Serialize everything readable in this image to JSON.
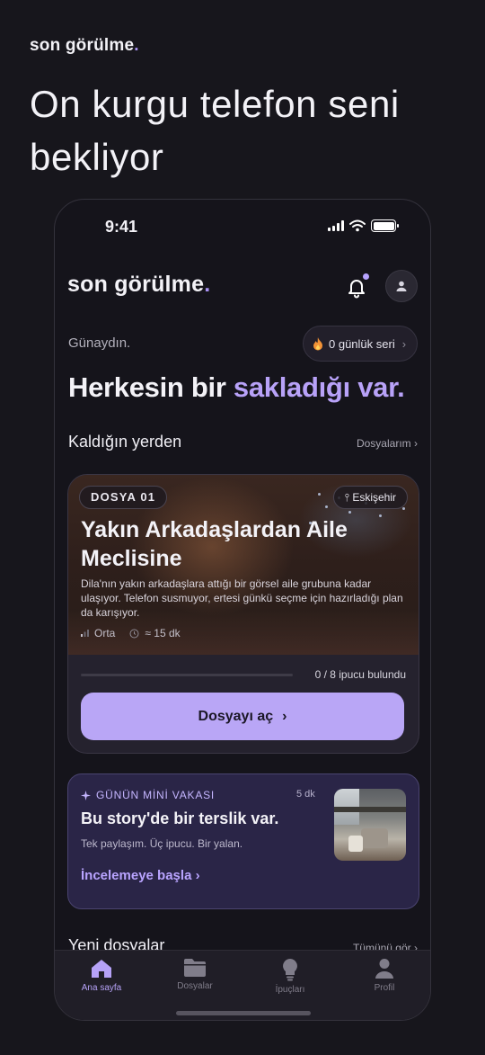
{
  "marketing": {
    "brand": "son görülme",
    "brand_dot": ".",
    "headline": "On kurgu telefon seni bekliyor"
  },
  "status_bar": {
    "time": "9:41"
  },
  "app": {
    "logo": "son görülme",
    "logo_dot": ".",
    "icons": {
      "notification": "bell-icon",
      "profile": "user-icon"
    }
  },
  "home": {
    "greeting": "Günaydın.",
    "streak_label": "0 günlük seri",
    "hero_plain": "Herkesin bir ",
    "hero_accent": "sakladığı var.",
    "continue_section": {
      "title": "Kaldığın yerden",
      "link": "Dosyalarım"
    },
    "case": {
      "badge": "DOSYA 01",
      "location": "Eskişehir",
      "title": "Yakın Arkadaşlardan Aile Meclisine",
      "description": "Dila'nın yakın arkadaşlara attığı bir görsel aile grubuna kadar ulaşıyor. Telefon susmuyor, ertesi günkü seçme için hazırladığı plan da karışıyor.",
      "difficulty": "Orta",
      "duration": "≈ 15 dk",
      "progress_label": "0 / 8 ipucu bulundu",
      "progress": 0,
      "button": "Dosyayı aç"
    },
    "mini_case": {
      "tag": "GÜNÜN MİNİ VAKASI",
      "time": "5 dk",
      "title": "Bu story'de bir terslik var.",
      "subtitle": "Tek paylaşım. Üç ipucu. Bir yalan.",
      "link": "İncelemeye başla"
    },
    "new_section": {
      "title": "Yeni dosyalar",
      "link": "Tümünü gör"
    }
  },
  "tabs": [
    {
      "label": "Ana sayfa",
      "icon": "home-icon",
      "active": true
    },
    {
      "label": "Dosyalar",
      "icon": "folder-icon",
      "active": false
    },
    {
      "label": "İpuçları",
      "icon": "lightbulb-icon",
      "active": false
    },
    {
      "label": "Profil",
      "icon": "user-icon",
      "active": false
    }
  ],
  "colors": {
    "accent": "#b8a2f8",
    "background": "#17161c",
    "card": "#25222e",
    "mini_card": "#2a2547"
  }
}
